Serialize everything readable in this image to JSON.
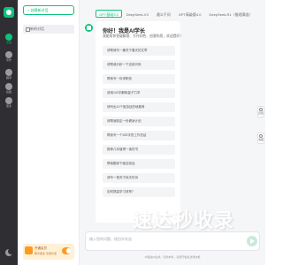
{
  "rail": {
    "items": [
      {
        "label": "对话",
        "icon": "chat-icon",
        "active": true
      },
      {
        "label": "写作",
        "icon": "pen-icon",
        "active": false
      },
      {
        "label": "翻译",
        "icon": "translate-icon",
        "active": false
      },
      {
        "label": "绘图",
        "icon": "image-icon",
        "active": false
      },
      {
        "label": "更多",
        "icon": "grid-icon",
        "active": false
      }
    ]
  },
  "sidebar": {
    "new_chat": "+ 创建新对话",
    "conversation": "新的对话",
    "promo_title": "开通会员",
    "promo_sub": "畅享更多 无限对话"
  },
  "tabs": [
    {
      "label": "GPT基础3.5",
      "active": true
    },
    {
      "label": "DeepSeek-V3",
      "active": false
    },
    {
      "label": "通义千问",
      "active": false
    },
    {
      "label": "GPT高级版4.0",
      "active": false
    },
    {
      "label": "DeepSeek-R1（推理满血）",
      "active": false
    }
  ],
  "welcome": {
    "title": "你好！我是AI学长",
    "subtitle": "我能帮你答疑解惑、写作润色、创意构思，欢迎提问！"
  },
  "suggestions": [
    "请帮我写一篇关于春天的文章",
    "请帮我分析一下这段代码",
    "帮我写一封求职信",
    "请用100字解释量子力学",
    "请列出10个旅游目的地推荐",
    "请帮我制定一份健身计划",
    "帮我写一个300字的工作总结",
    "推荐几本值得一读的书",
    "帮我翻译下面这段话",
    "请写一首关于秋天的诗",
    "如何提高学习效率？"
  ],
  "float_buttons": [
    {
      "label": "反馈",
      "icon": "feedback-icon"
    },
    {
      "label": "客服",
      "icon": "headset-icon"
    }
  ],
  "input": {
    "placeholder": "输入您的问题，按回车发送"
  },
  "disclaimer": "内容由AI生成，仅供参考，请遵守相关法律法规",
  "watermark": "速达秒收录",
  "colors": {
    "accent": "#0ec27c",
    "rail_bg": "#2e2e33",
    "main_bg": "#f5f6f8",
    "promo_bg": "#fff1d6"
  }
}
